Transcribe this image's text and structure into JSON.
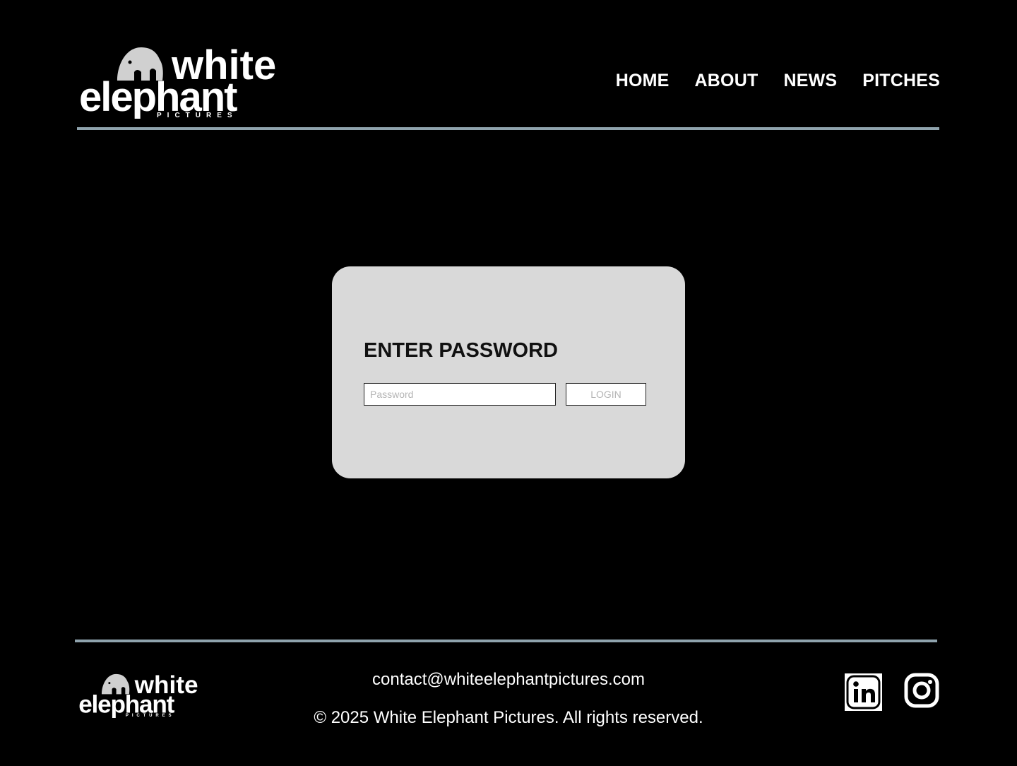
{
  "brand": {
    "line1": "white",
    "line2": "elephant",
    "tagline": "PICTURES"
  },
  "nav": {
    "items": [
      {
        "label": "HOME"
      },
      {
        "label": "ABOUT"
      },
      {
        "label": "NEWS"
      },
      {
        "label": "PITCHES"
      }
    ]
  },
  "login": {
    "title": "ENTER PASSWORD",
    "password_placeholder": "Password",
    "password_value": "",
    "button_label": "LOGIN"
  },
  "footer": {
    "email": "contact@whiteelephantpictures.com",
    "copyright": "© 2025 White Elephant Pictures. All rights reserved.",
    "social": [
      {
        "icon": "linkedin-icon"
      },
      {
        "icon": "instagram-icon"
      }
    ]
  },
  "colors": {
    "background": "#000000",
    "card": "#d9d9d9",
    "divider": "#8fa3ad",
    "elephant": "#d0d0d0"
  }
}
